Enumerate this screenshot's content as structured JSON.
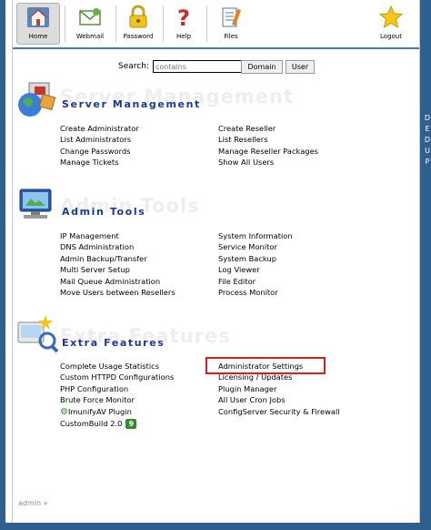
{
  "toolbar": {
    "items": [
      {
        "label": "Home",
        "icon": "house-icon"
      },
      {
        "label": "Webmail",
        "icon": "mail-icon"
      },
      {
        "label": "Password",
        "icon": "lock-icon"
      },
      {
        "label": "Help",
        "icon": "help-icon"
      },
      {
        "label": "Files",
        "icon": "files-icon"
      },
      {
        "label": "Logout",
        "icon": "star-icon"
      }
    ]
  },
  "search": {
    "label": "Search:",
    "placeholder": "contains",
    "domain_button": "Domain",
    "user_button": "User"
  },
  "sections": {
    "server": {
      "title": "Server Management",
      "watermark": "Server Management",
      "left": [
        "Create Administrator",
        "List Administrators",
        "Change Passwords",
        "Manage Tickets"
      ],
      "right": [
        "Create Reseller",
        "List Resellers",
        "Manage Reseller Packages",
        "Show All Users"
      ]
    },
    "admin": {
      "title": "Admin Tools",
      "watermark": "Admin Tools",
      "left": [
        "IP Management",
        "DNS Administration",
        "Admin Backup/Transfer",
        "Multi Server Setup",
        "Mail Queue Administration",
        "Move Users between Resellers"
      ],
      "right": [
        "System Information",
        "Service Monitor",
        "System Backup",
        "Log Viewer",
        "File Editor",
        "Process Monitor"
      ]
    },
    "extra": {
      "title": "Extra Features",
      "watermark": "Extra Features",
      "left": [
        "Complete Usage Statistics",
        "Custom HTTPD Configurations",
        "PHP Configuration",
        "Brute Force Monitor",
        "ImunifyAV Plugin",
        "CustomBuild 2.0"
      ],
      "custombuild_badge": "9",
      "right": [
        "Administrator Settings",
        "Licensing / Updates",
        "Plugin Manager",
        "All User Cron Jobs",
        "ConfigServer Security & Firewall"
      ]
    }
  },
  "side_letters": [
    "D",
    "E",
    "D",
    "U",
    "P"
  ],
  "footer": {
    "breadcrumb": "admin",
    "separator": "»"
  },
  "colors": {
    "frame": "#2f5f8f",
    "section_title": "#1a3a9a",
    "highlight": "#e01b1b",
    "badge": "#2f8f2f"
  }
}
